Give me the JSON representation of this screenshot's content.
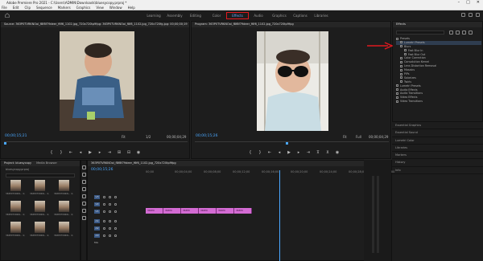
{
  "window": {
    "title": "Adobe Premiere Pro 2021 - C:\\Users\\ADMIN\\Downloads\\bluesycopy.prproj *",
    "buttons": [
      "–",
      "□",
      "✕"
    ]
  },
  "menu": [
    "File",
    "Edit",
    "Clip",
    "Sequence",
    "Markers",
    "Graphics",
    "View",
    "Window",
    "Help"
  ],
  "workspaces": {
    "tabs": [
      "Learning",
      "Assembly",
      "Editing",
      "Color",
      "Effects",
      "Audio",
      "Graphics",
      "Captions",
      "Libraries"
    ],
    "active": "Effects"
  },
  "source": {
    "tab": "Source: 363P0TVRKNOoi_f8f8f79deer_f6f6_1102.jpg_720x720tp9fpg: 363P0TVRKNOoi_f8f8_1102.jpg_720x720fg.jpg: 00;00;00;19",
    "timecode_left": "00;00;15;21",
    "fit": "Fit",
    "quality": "1/2",
    "timecode_right": "00;00;04;29"
  },
  "program": {
    "tab": "Program: 363P0TVRKNOoi_f8f8f79deer_f6f6_1102.jpg_720x720tp9fpg",
    "timecode_left": "00;00;15;26",
    "fit": "Fit",
    "quality": "Full",
    "timecode_right": "00;00;04;29"
  },
  "effects": {
    "tab": "Effects",
    "items": [
      {
        "label": "Presets",
        "depth": 0,
        "selected": false
      },
      {
        "label": "Lumetri Presets",
        "depth": 1,
        "selected": true
      },
      {
        "label": "Blurs",
        "depth": 1,
        "selected": false
      },
      {
        "label": "Fast Blur In",
        "depth": 2,
        "selected": false
      },
      {
        "label": "Fast Blur Out",
        "depth": 2,
        "selected": false
      },
      {
        "label": "Color Correction",
        "depth": 1,
        "selected": false
      },
      {
        "label": "Convolution Kernel",
        "depth": 1,
        "selected": false
      },
      {
        "label": "Lens Distortion Removal",
        "depth": 1,
        "selected": false
      },
      {
        "label": "Mosaics",
        "depth": 1,
        "selected": false
      },
      {
        "label": "PiPs",
        "depth": 1,
        "selected": false
      },
      {
        "label": "Solarizes",
        "depth": 1,
        "selected": false
      },
      {
        "label": "Twirls",
        "depth": 1,
        "selected": false
      },
      {
        "label": "Lumetri Presets",
        "depth": 0,
        "selected": false
      },
      {
        "label": "Audio Effects",
        "depth": 0,
        "selected": false
      },
      {
        "label": "Audio Transitions",
        "depth": 0,
        "selected": false
      },
      {
        "label": "Video Effects",
        "depth": 0,
        "selected": false
      },
      {
        "label": "Video Transitions",
        "depth": 0,
        "selected": false
      }
    ],
    "panels": [
      "Essential Graphics",
      "Essential Sound",
      "Lumetri Color",
      "Libraries",
      "Markers",
      "History",
      "Info"
    ]
  },
  "project": {
    "tabs": [
      "Project: bluesycopy",
      "Media Browser"
    ],
    "file": "bluesycopy.prproj",
    "clips": [
      {
        "label": "363P0TVRKN...",
        "duration": "4;29"
      },
      {
        "label": "363P0TVRKN...",
        "duration": "4;29"
      },
      {
        "label": "363P0TVRKN...",
        "duration": "4;29"
      },
      {
        "label": "363P0TVRKN...",
        "duration": "4;29"
      },
      {
        "label": "363P0TVRKN...",
        "duration": "4;29"
      },
      {
        "label": "363P0TVRKN...",
        "duration": "4;29"
      },
      {
        "label": "363P0TVRKN...",
        "duration": "4;29"
      },
      {
        "label": "363P0TVRKN...",
        "duration": "4;29"
      },
      {
        "label": "363P0TVRKN...",
        "duration": "4;29"
      }
    ]
  },
  "timeline": {
    "tab": "363P0TVRKNOoi_f8f8f79deer_f6f6_1102.jpg_720x720tp9fpg",
    "timecode": "00;00;15;26",
    "ruler": [
      "00;00",
      "00;00;04;00",
      "00;00;08;00",
      "00;00;12;00",
      "00;00;16;00",
      "00;00;20;00",
      "00;00;24;00",
      "00;00;28;00",
      "00;00;32;00"
    ],
    "video_tracks": [
      "V3",
      "V2",
      "V1"
    ],
    "audio_tracks": [
      "A1",
      "A2",
      "A3"
    ],
    "master": "Mix",
    "clips": [
      "363P0",
      "363P0",
      "363P0",
      "363P0",
      "363P0",
      "363P0"
    ]
  },
  "colors": {
    "accent": "#4aa8ff",
    "clip": "#d36bd3",
    "highlight": "#e0191f"
  }
}
